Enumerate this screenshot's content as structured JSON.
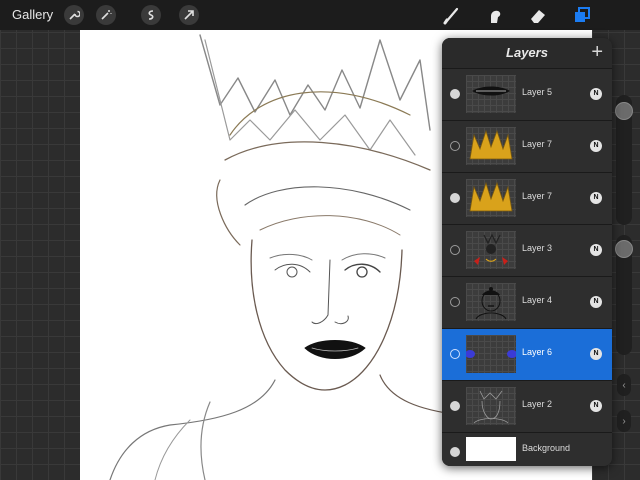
{
  "toolbar": {
    "gallery_label": "Gallery",
    "left_tools": [
      "wrench-icon",
      "magic-wand-icon",
      "selection-icon",
      "transform-arrow-icon"
    ],
    "right_tools": [
      "brush-icon",
      "smudge-icon",
      "eraser-icon",
      "layers-icon"
    ],
    "accent_color": "#1b7cf2"
  },
  "layers_panel": {
    "title": "Layers",
    "add_label": "+",
    "layers": [
      {
        "name": "Layer 5",
        "blend": "N",
        "visible": true,
        "selected": false,
        "thumb": "lips"
      },
      {
        "name": "Layer 7",
        "blend": "N",
        "visible": false,
        "selected": false,
        "thumb": "crown"
      },
      {
        "name": "Layer 7",
        "blend": "N",
        "visible": true,
        "selected": false,
        "thumb": "crown"
      },
      {
        "name": "Layer 3",
        "blend": "N",
        "visible": false,
        "selected": false,
        "thumb": "figure"
      },
      {
        "name": "Layer 4",
        "blend": "N",
        "visible": false,
        "selected": false,
        "thumb": "portrait"
      },
      {
        "name": "Layer 6",
        "blend": "N",
        "visible": false,
        "selected": true,
        "thumb": "dots"
      },
      {
        "name": "Layer 2",
        "blend": "N",
        "visible": true,
        "selected": false,
        "thumb": "sketch"
      },
      {
        "name": "Background",
        "blend": "",
        "visible": true,
        "selected": false,
        "thumb": "white"
      }
    ],
    "selected_color": "#1b6ed8"
  }
}
